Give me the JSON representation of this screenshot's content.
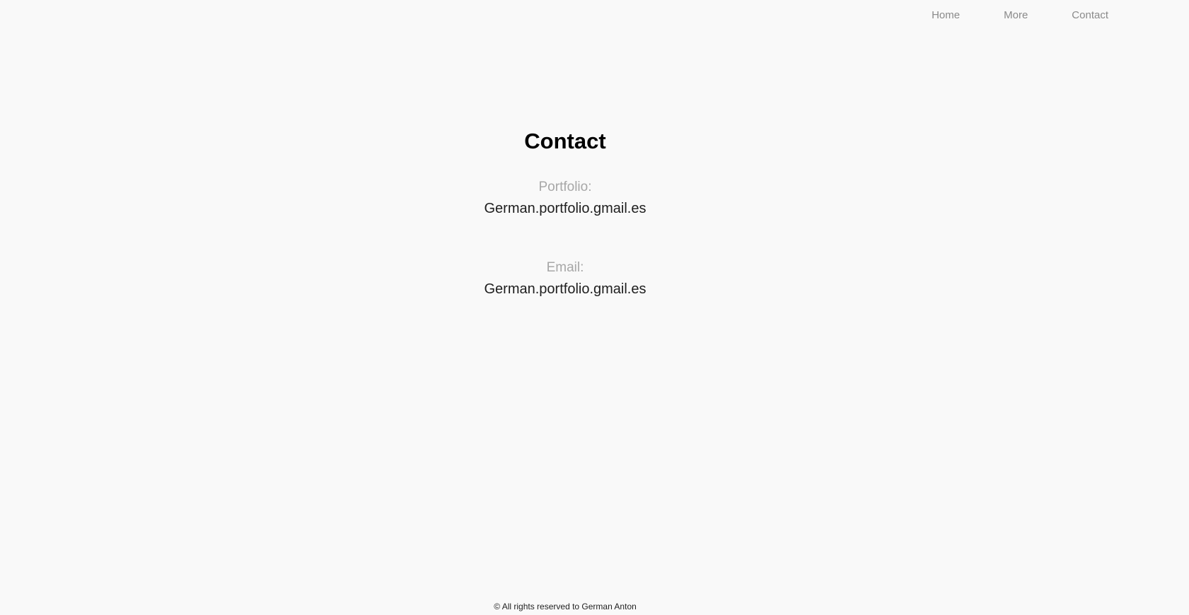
{
  "nav": {
    "items": [
      {
        "label": "Home"
      },
      {
        "label": "More"
      },
      {
        "label": "Contact"
      }
    ]
  },
  "main": {
    "title": "Contact",
    "entries": [
      {
        "label": "Portfolio:",
        "value": "German.portfolio.gmail.es"
      },
      {
        "label": "Email:",
        "value": "German.portfolio.gmail.es"
      }
    ]
  },
  "footer": {
    "text": "© All rights reserved to German Anton"
  }
}
